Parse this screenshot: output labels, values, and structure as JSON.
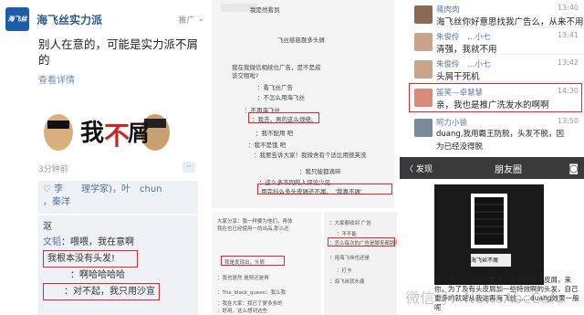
{
  "left": {
    "logo_text": "海飞丝",
    "account_name": "海飞丝实力派",
    "tag": "推广",
    "ad_text": "别人在意的，可能是实力派不屑的",
    "detail_link": "查看详情",
    "image_text": [
      "我",
      "不",
      "屑"
    ],
    "time": "3分钟前",
    "likes": "♡ 李　　理学家)，叶　chun",
    "likes_line2": "，秦洋",
    "comments": [
      {
        "author": "沤",
        "text": ""
      },
      {
        "author": "文韬",
        "text": "喂喂，我在意啊"
      },
      {
        "author": "",
        "text": "我根本没有头发!"
      },
      {
        "author": "",
        "text": "：啊哈哈哈哈"
      },
      {
        "author": "",
        "text": "：对不起，我只用沙宣"
      }
    ]
  },
  "middle": {
    "lines": [
      "我是然看到",
      "飞丝慈慈题多头屑",
      "我在我微信相续位广告，是不是成",
      "该交租啦?",
      "：看飞丝广告",
      "：不怎么用海飞丝",
      "：不用海飞丝",
      "：我去，男的这么烦佬。",
      "：我不配用 吧",
      "：我不是饿 吧",
      "：我要告诉大家！我微舍有个适比用德芙洗",
      "：我只能都滴碎",
      "：这么多不同的人评论少见",
      "用完抖么多头皮屑还不属。　'我喜不屑'"
    ],
    "bottom1": [
      "大家分享：我一样要为他们，再体",
      "我在也已经使用一的出品,那么还",
      "我是发现出，头屑",
      "：我也居然 是呀还是再",
      "：The_black_queen：我么我",
      "：我在大家：我已了更多多的",
      "：好用，这么想到这些"
    ],
    "bottom2": [
      "：大家都收到 广告",
      "：不不能",
      "：怎么每次的广告是脚来都跳来",
      "：用海飞丝也还是",
      "：打卡",
      "：海飞丝就头痛"
    ]
  },
  "right_top": {
    "comments": [
      {
        "name": "蒋肉肉",
        "time": "13:40",
        "text": "海飞丝你好意思找我广告么，从来不用"
      },
      {
        "name": "朱俊伶　…小七",
        "time": "13:41",
        "text": "清强，我就不用"
      },
      {
        "name": "朱俊伶　…小七",
        "time": "13:42",
        "text": "头屑干死机"
      },
      {
        "name": "笛笑—卓慧慧",
        "time": "14:30",
        "text": "亲，我也是推广洗发水的啊啊"
      },
      {
        "name": "阿力小徐",
        "time": "13:50",
        "text": "duang,我用霸王防脱，头发不脱，因"
      },
      {
        "name": "",
        "time": "",
        "text": "为已经没得脱"
      }
    ]
  },
  "right_bottom": {
    "back_label": "〈 发现",
    "title": "朋友圈",
    "image_caption": "海飞丝不屑",
    "caption": "你一次比我用我头要发，全部都有头皮屑，来你，为了及有头皮屑加一些特效啊的头发，自己更多的就是从我这再海飞丝……duang效果一般呢"
  },
  "watermark": "微信号：NewsAbcCafe",
  "colors": {
    "accent_red": "#e0262f",
    "link_blue": "#5673a0",
    "bar_dark": "#393a3e"
  }
}
